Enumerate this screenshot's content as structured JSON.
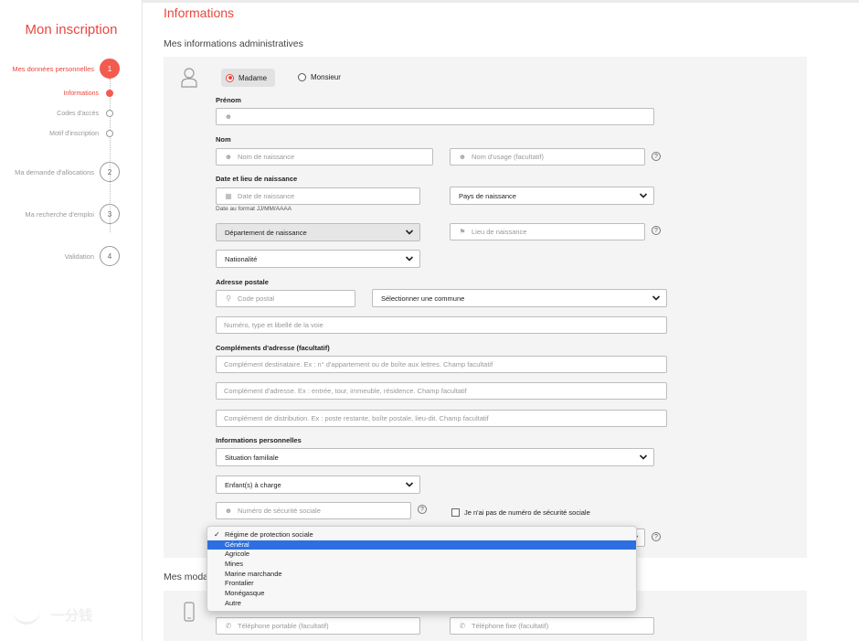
{
  "sidebar": {
    "title": "Mon inscription",
    "steps": [
      {
        "label": "Mes données personnelles",
        "number": "1",
        "active": true
      },
      {
        "label": "Ma demande d'allocations",
        "number": "2"
      },
      {
        "label": "Ma recherche d'emploi",
        "number": "3"
      },
      {
        "label": "Validation",
        "number": "4"
      }
    ],
    "substeps": [
      {
        "label": "Informations",
        "active": true
      },
      {
        "label": "Codes d'accès"
      },
      {
        "label": "Motif d'inscription"
      }
    ],
    "watermark": "一分钱"
  },
  "page": {
    "title": "Informations",
    "admin_section": "Mes informations administratives",
    "contact_section": "Mes moda"
  },
  "form": {
    "gender": {
      "madame": "Madame",
      "monsieur": "Monsieur",
      "selected": "Madame"
    },
    "prenom_label": "Prénom",
    "nom_label": "Nom",
    "nom_naissance_placeholder": "Nom de naissance",
    "nom_usage_placeholder": "Nom d'usage (facultatif)",
    "naissance_label": "Date et lieu de naissance",
    "date_naissance_placeholder": "Date de naissance",
    "date_hint": "Date au format JJ/MM/AAAA",
    "pays_naissance": "Pays de naissance",
    "departement_naissance": "Département de naissance",
    "lieu_naissance_placeholder": "Lieu de naissance",
    "nationalite": "Nationalité",
    "adresse_label": "Adresse postale",
    "code_postal_placeholder": "Code postal",
    "commune": "Sélectionner une commune",
    "voie_placeholder": "Numéro, type et libellé de la voie",
    "complements_label": "Compléments d'adresse (facultatif)",
    "complement1_placeholder": "Complément destinataire. Ex : n° d'appartement ou de boîte aux lettres. Champ facultatif",
    "complement2_placeholder": "Complément d'adresse. Ex : entrée, tour, immeuble, résidence. Champ facultatif",
    "complement3_placeholder": "Complément de distribution. Ex : poste restante, boîte postale, lieu-dit. Champ facultatif",
    "infos_label": "Informations personnelles",
    "situation_familiale": "Situation familiale",
    "enfants": "Enfant(s) à charge",
    "secu_placeholder": "Numéro de sécurité sociale",
    "no_secu_label": "Je n'ai pas de numéro de sécurité sociale",
    "telephone_portable_placeholder": "Téléphone portable (facultatif)",
    "telephone_fixe_placeholder": "Téléphone fixe (facultatif)",
    "help_glyph": "?"
  },
  "dropdown": {
    "options": [
      {
        "label": "Régime de protection sociale",
        "checked": true
      },
      {
        "label": "Général",
        "highlighted": true
      },
      {
        "label": "Agricole"
      },
      {
        "label": "Mines"
      },
      {
        "label": "Marine marchande"
      },
      {
        "label": "Frontalier"
      },
      {
        "label": "Monégasque"
      },
      {
        "label": "Autre"
      }
    ]
  },
  "colors": {
    "accent": "#e8473d",
    "highlight": "#2d6fe0",
    "panel": "#f4f4f4"
  }
}
